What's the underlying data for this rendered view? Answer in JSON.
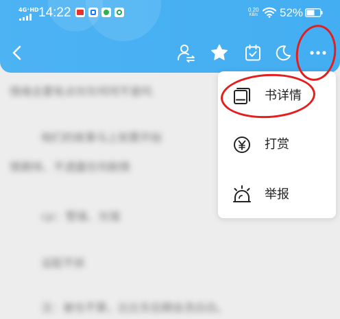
{
  "status_bar": {
    "network": "4G⁺HD",
    "time": "14:22",
    "net_speed_value": "0.20",
    "net_speed_unit": "KB/s",
    "battery": "52%"
  },
  "toolbar": {
    "back": "back-icon",
    "author": "author-switch-icon",
    "favorite": "star-icon",
    "checkin": "calendar-check-icon",
    "night_mode": "moon-icon",
    "more": "more-dots-icon"
  },
  "menu": {
    "items": [
      {
        "icon": "book-detail-icon",
        "label": "书详情"
      },
      {
        "icon": "yen-coin-icon",
        "label": "打赏"
      },
      {
        "icon": "report-alarm-icon",
        "label": "举报"
      }
    ]
  },
  "content": {
    "lines": [
      "情缘总要有点坎坎坷坷不是吗",
      "咱们的故事马上就要开始",
      "情期待、不透露任何剧情",
      "cp：雪瑞、光瑞",
      "设配不拆",
      "注：被也不算，比比东后期会洗白白。"
    ]
  },
  "colors": {
    "header_blue": "#45b0f2",
    "annotation_red": "#e51d1d",
    "menu_bg": "#ffffff",
    "page_bg": "#ededed"
  }
}
